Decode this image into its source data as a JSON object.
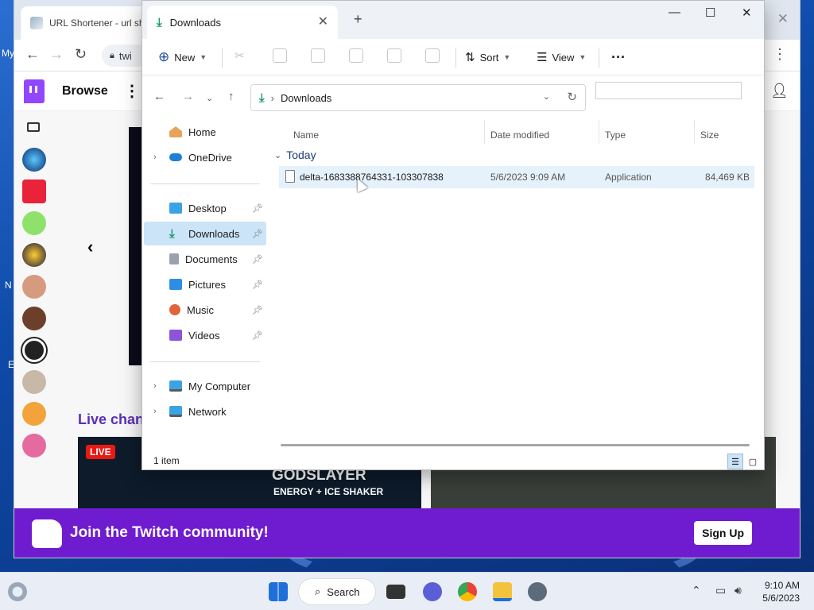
{
  "desktop": {
    "frag_top": "My",
    "frag_mid": "N",
    "frag_bot": "E"
  },
  "chrome": {
    "tab_title": "URL Shortener - url sh",
    "address_text": "twi",
    "close_glyph": "✕"
  },
  "twitch": {
    "browse_label": "Browse",
    "live_channels_label": "Live chan",
    "live_badge": "LIVE",
    "card_text_1": "GODSLAYER",
    "card_text_2": "ENERGY + ICE SHAKER",
    "banner_text": "Join the Twitch community!",
    "signup_label": "Sign Up",
    "accent": "#9146ff"
  },
  "explorer": {
    "tab_title": "Downloads",
    "toolbar": {
      "new_label": "New",
      "sort_label": "Sort",
      "view_label": "View"
    },
    "path_label": "Downloads",
    "nav": {
      "home": "Home",
      "onedrive": "OneDrive",
      "desktop": "Desktop",
      "downloads": "Downloads",
      "documents": "Documents",
      "pictures": "Pictures",
      "music": "Music",
      "videos": "Videos",
      "my_computer": "My Computer",
      "network": "Network"
    },
    "columns": {
      "name": "Name",
      "date": "Date modified",
      "type": "Type",
      "size": "Size"
    },
    "group_label": "Today",
    "file": {
      "name": "delta-1683388764331-103307838",
      "date": "5/6/2023 9:09 AM",
      "type": "Application",
      "size": "84,469 KB"
    },
    "status": "1 item"
  },
  "taskbar": {
    "search_label": "Search",
    "time": "9:10 AM",
    "date": "5/6/2023"
  }
}
